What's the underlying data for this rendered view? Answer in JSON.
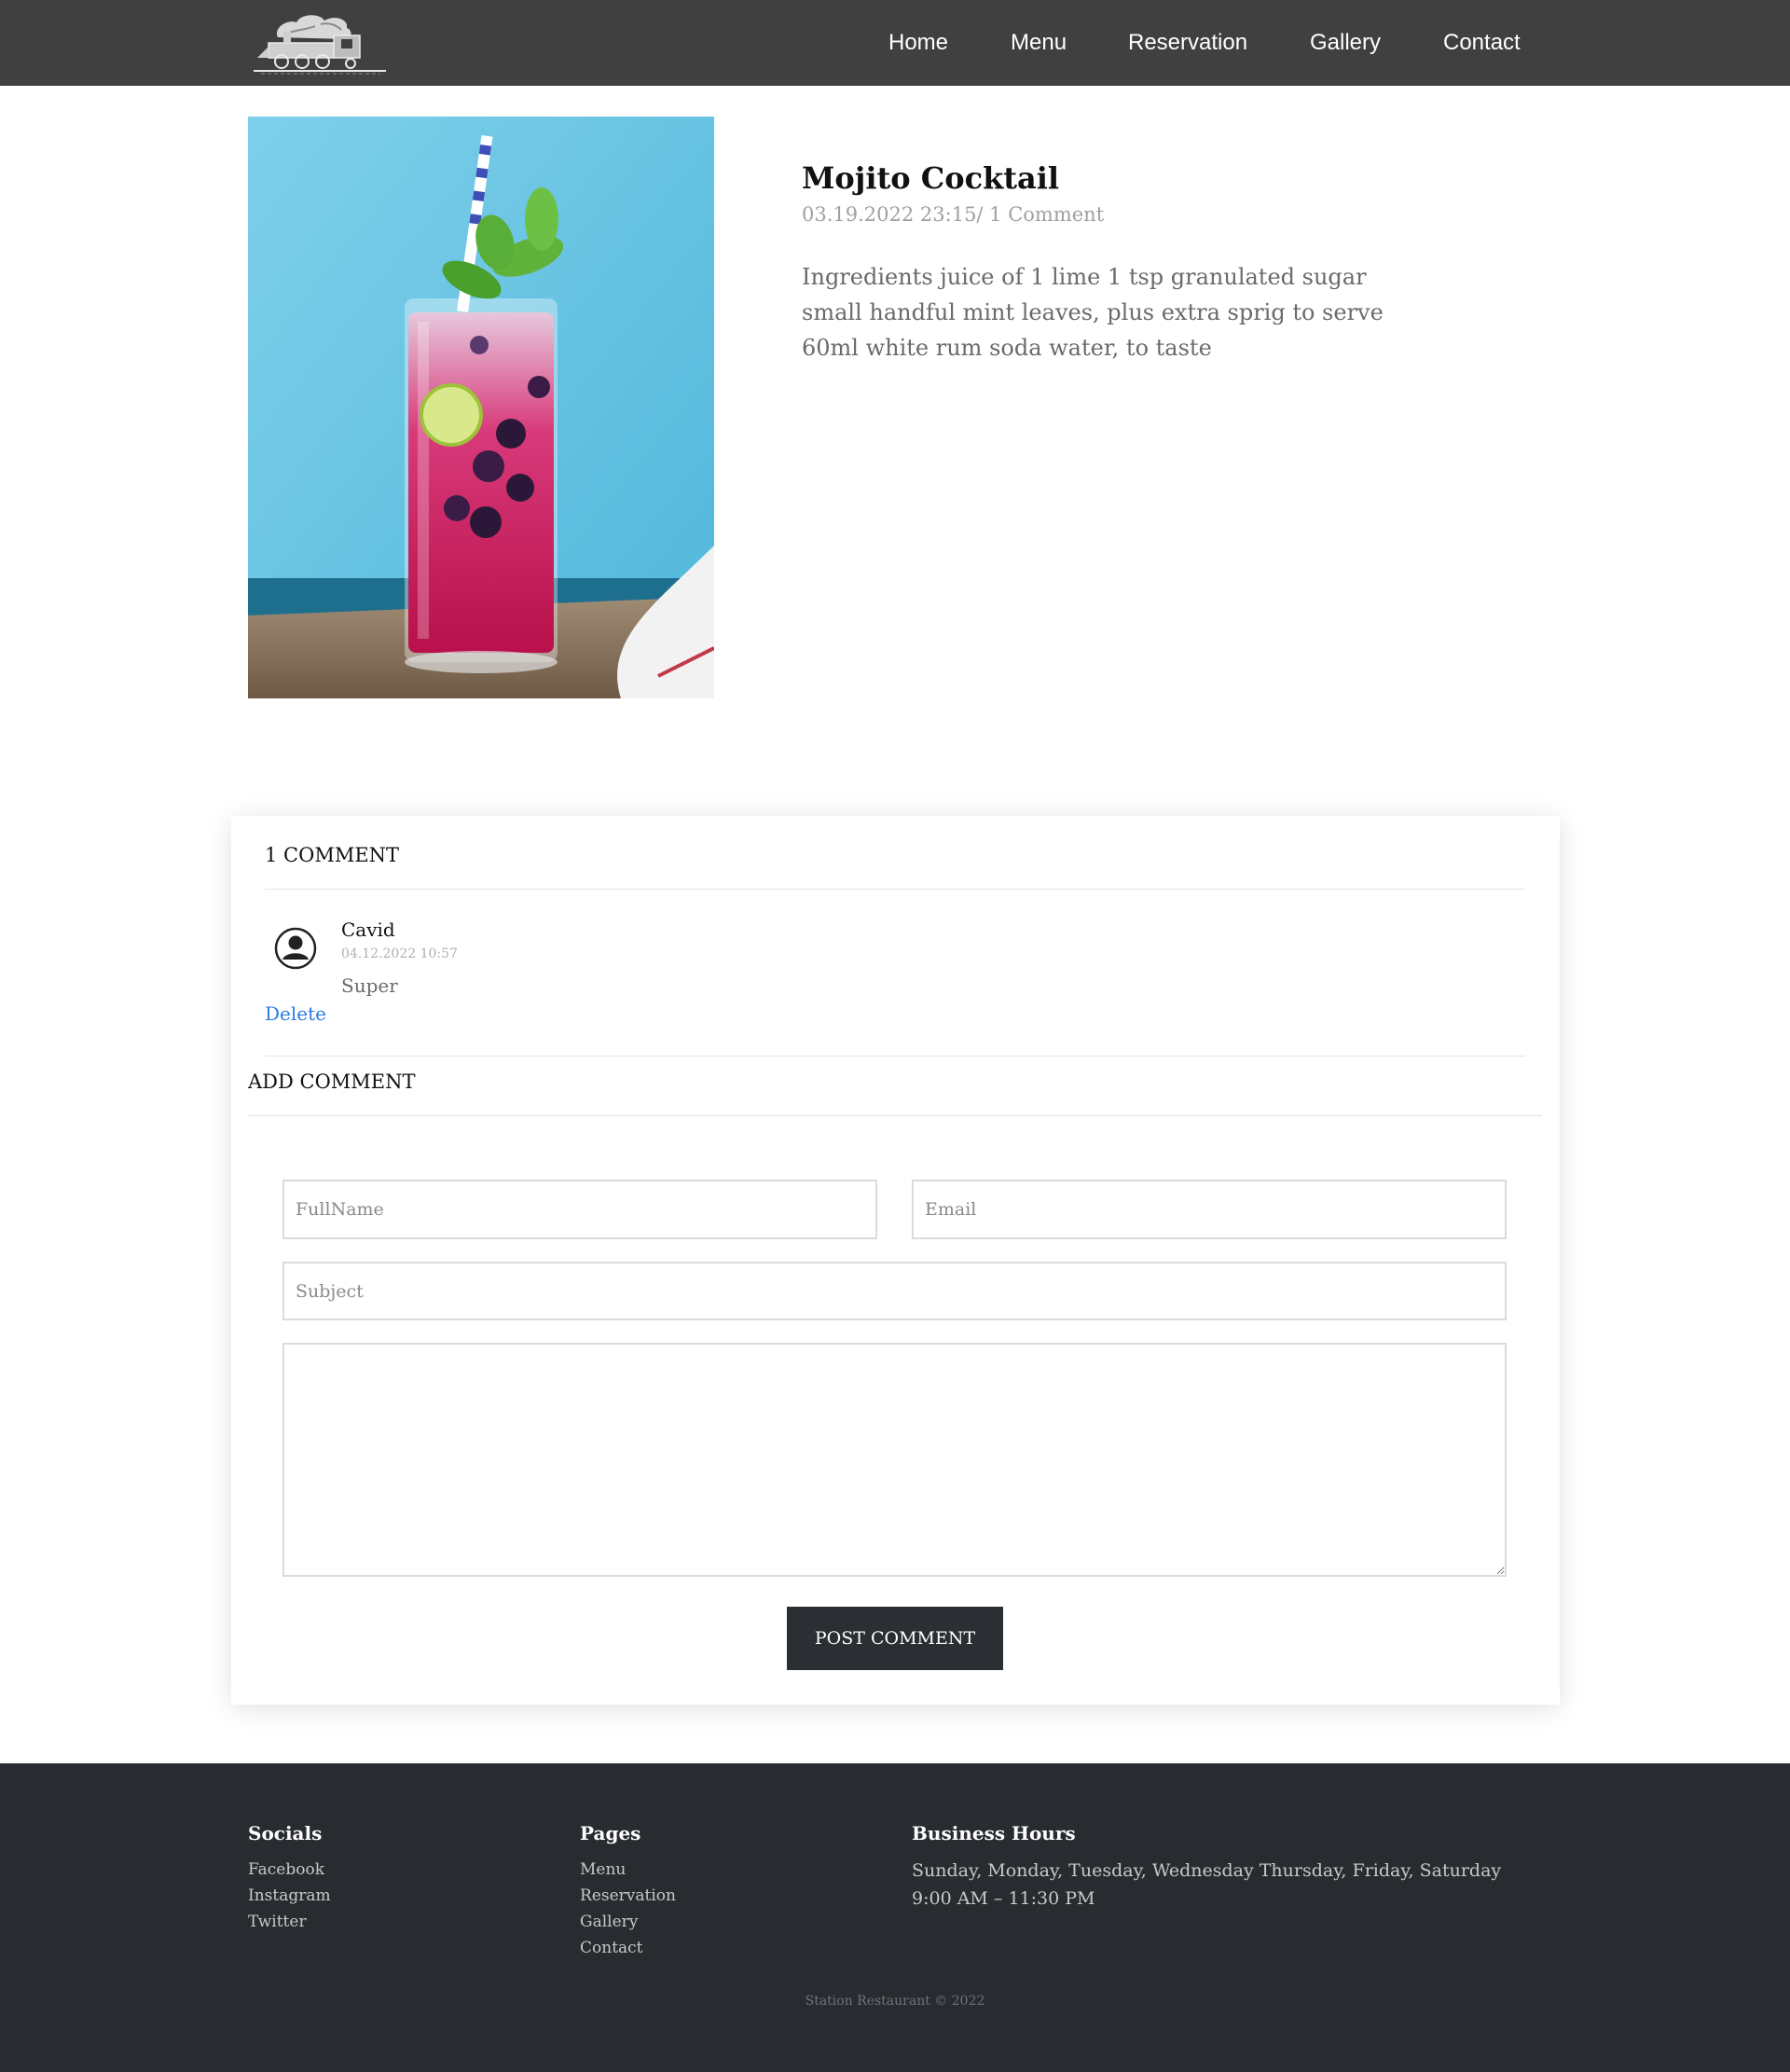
{
  "header": {
    "nav": [
      "Home",
      "Menu",
      "Reservation",
      "Gallery",
      "Contact"
    ]
  },
  "post": {
    "title": "Mojito Cocktail",
    "meta": "03.19.2022 23:15/ 1 Comment",
    "body": "Ingredients juice of 1 lime 1 tsp granulated sugar small handful mint leaves, plus extra sprig to serve 60ml white rum soda water, to taste"
  },
  "comments": {
    "heading": "1 COMMENT",
    "items": [
      {
        "author": "Cavid",
        "date": "04.12.2022 10:57",
        "text": "Super",
        "delete_label": "Delete"
      }
    ]
  },
  "add_comment": {
    "heading": "ADD COMMENT",
    "fullname_placeholder": "FullName",
    "email_placeholder": "Email",
    "subject_placeholder": "Subject",
    "message_placeholder": "",
    "submit_label": "POST COMMENT"
  },
  "footer": {
    "socials_heading": "Socials",
    "socials": [
      "Facebook",
      "Instagram",
      "Twitter"
    ],
    "pages_heading": "Pages",
    "pages": [
      "Menu",
      "Reservation",
      "Gallery",
      "Contact"
    ],
    "hours_heading": "Business Hours",
    "hours_days": "Sunday, Monday, Tuesday, Wednesday Thursday, Friday, Saturday",
    "hours_time": "9:00 AM – 11:30 PM",
    "copyright": "Station Restaurant © 2022"
  },
  "colors": {
    "header_bg": "#404040",
    "footer_bg": "#282c30",
    "button_bg": "#2b2f33",
    "link_blue": "#2a7ae2"
  }
}
